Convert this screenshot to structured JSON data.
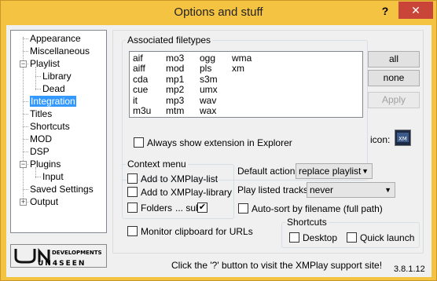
{
  "window": {
    "title": "Options and stuff",
    "help_label": "?",
    "close_label": "✕"
  },
  "tree": [
    {
      "label": "Appearance",
      "selected": false
    },
    {
      "label": "Miscellaneous",
      "selected": false
    },
    {
      "label": "Playlist",
      "selected": false
    },
    {
      "label": "Library",
      "selected": false
    },
    {
      "label": "Dead",
      "selected": false
    },
    {
      "label": "Integration",
      "selected": true
    },
    {
      "label": "Titles",
      "selected": false
    },
    {
      "label": "Shortcuts",
      "selected": false
    },
    {
      "label": "MOD",
      "selected": false
    },
    {
      "label": "DSP",
      "selected": false
    },
    {
      "label": "Plugins",
      "selected": false
    },
    {
      "label": "Input",
      "selected": false
    },
    {
      "label": "Saved Settings",
      "selected": false
    },
    {
      "label": "Output",
      "selected": false
    }
  ],
  "tree_expanders": {
    "minus": "−",
    "plus": "+"
  },
  "logo": {
    "text": "UN4SEEN",
    "sub": "DEVELOPMENTS"
  },
  "filetypes": {
    "legend": "Associated filetypes",
    "columns": [
      [
        "aif",
        "aiff",
        "cda",
        "cue",
        "it",
        "m3u"
      ],
      [
        "mo3",
        "mod",
        "mp1",
        "mp2",
        "mp3",
        "mtm"
      ],
      [
        "ogg",
        "pls",
        "s3m",
        "umx",
        "wav",
        "wax"
      ],
      [
        "wma",
        "xm"
      ]
    ],
    "all_label": "all",
    "none_label": "none",
    "apply_label": "Apply",
    "always_show_label": "Always show extension in Explorer",
    "always_show_checked": false,
    "icon_label": "icon:"
  },
  "context_menu": {
    "legend": "Context menu",
    "add_playlist_label": "Add to XMPlay-list",
    "add_playlist_checked": false,
    "add_library_label": "Add to XMPlay-library",
    "add_library_checked": false,
    "folders_label": "Folders",
    "folders_checked": false,
    "sub_label": "... sub",
    "sub_checked": true,
    "check_mark": "✔"
  },
  "default_action": {
    "label": "Default action:",
    "value": "replace playlist"
  },
  "play_listed": {
    "label": "Play listed tracks:",
    "value": "never"
  },
  "autosort": {
    "label": "Auto-sort by filename (full path)",
    "checked": false
  },
  "monitor": {
    "label": "Monitor clipboard for URLs",
    "checked": false
  },
  "shortcuts": {
    "legend": "Shortcuts",
    "desktop_label": "Desktop",
    "desktop_checked": false,
    "quicklaunch_label": "Quick launch",
    "quicklaunch_checked": false
  },
  "footer": {
    "support_text": "Click the '?' button to visit the XMPlay support site!",
    "version": "3.8.1.12"
  },
  "colors": {
    "frame": "#f5c342",
    "close": "#c9453a",
    "selection": "#3399ff"
  }
}
